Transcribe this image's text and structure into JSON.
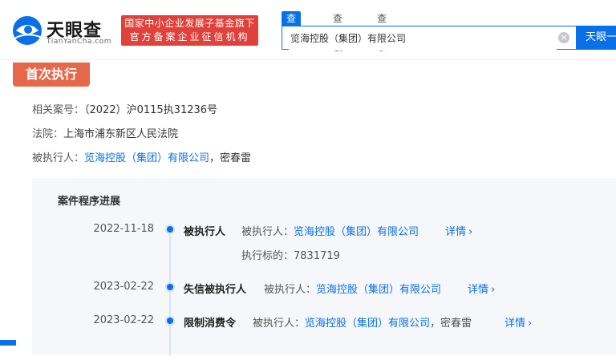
{
  "header": {
    "logo_title": "天眼查",
    "logo_subtitle": "TianYanCha.com",
    "badge_line1": "国家中小企业发展子基金旗下",
    "badge_line2": "官方备案企业征信机构",
    "tabs": [
      "查公司",
      "查老板",
      "查关系"
    ],
    "search_value": "览海控股（集团）有限公司",
    "search_button": "天眼一下"
  },
  "section": {
    "tag": "首次执行"
  },
  "info": {
    "case_label": "相关案号：",
    "case_value": "（2022）沪0115执31236号",
    "court_label": "法院：",
    "court_value": "上海市浦东新区人民法院",
    "party_label": "被执行人：",
    "party_company": "览海控股（集团）有限公司",
    "party_person": "，密春雷"
  },
  "progress": {
    "title": "案件程序进展",
    "items": [
      {
        "date": "2022-11-18",
        "title": "被执行人",
        "label": "被执行人：",
        "company": "览海控股（集团）有限公司",
        "detail": "详情",
        "extra": "执行标的：7831719"
      },
      {
        "date": "2023-02-22",
        "title": "失信被执行人",
        "label": "被执行人：",
        "company": "览海控股（集团）有限公司",
        "detail": "详情"
      },
      {
        "date": "2023-02-22",
        "title": "限制消费令",
        "label": "被执行人：",
        "company": "览海控股（集团）有限公司",
        "person": "，密春雷",
        "detail": "详情"
      }
    ]
  },
  "colors": {
    "brand_blue": "#0a70e8",
    "tag_orange": "#e5684a",
    "badge_red": "#e0413a"
  }
}
